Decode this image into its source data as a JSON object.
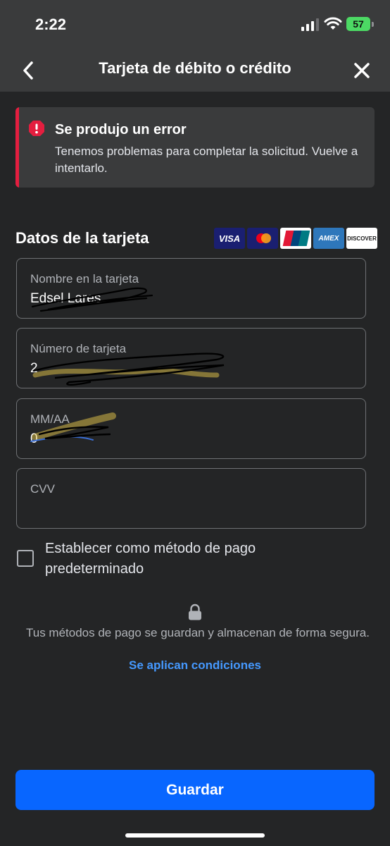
{
  "status_bar": {
    "time": "2:22",
    "battery_level": "57"
  },
  "header": {
    "title": "Tarjeta de débito o crédito"
  },
  "error": {
    "title": "Se produjo un error",
    "message": "Tenemos problemas para completar la solicitud. Vuelve a intentarlo."
  },
  "card_section": {
    "title": "Datos de la tarjeta",
    "logos": {
      "visa": "VISA",
      "amex": "AMEX",
      "discover": "DISCOVER"
    }
  },
  "form": {
    "name_label": "Nombre en la tarjeta",
    "name_value": "Edsel Lares",
    "number_label": "Número de tarjeta",
    "number_value": "2",
    "expiry_label": "MM/AA",
    "expiry_value": "0",
    "cvv_label": "CVV",
    "default_label": "Establecer como método de pago predeterminado"
  },
  "security": {
    "text": "Tus métodos de pago se guardan y almacenan de forma segura.",
    "terms_link": "Se aplican condiciones"
  },
  "actions": {
    "save_label": "Guardar"
  },
  "colors": {
    "background": "#242526",
    "surface": "#3a3b3c",
    "accent": "#0866ff",
    "link": "#4599ff",
    "error": "#e41e3f",
    "battery": "#4cd964"
  }
}
